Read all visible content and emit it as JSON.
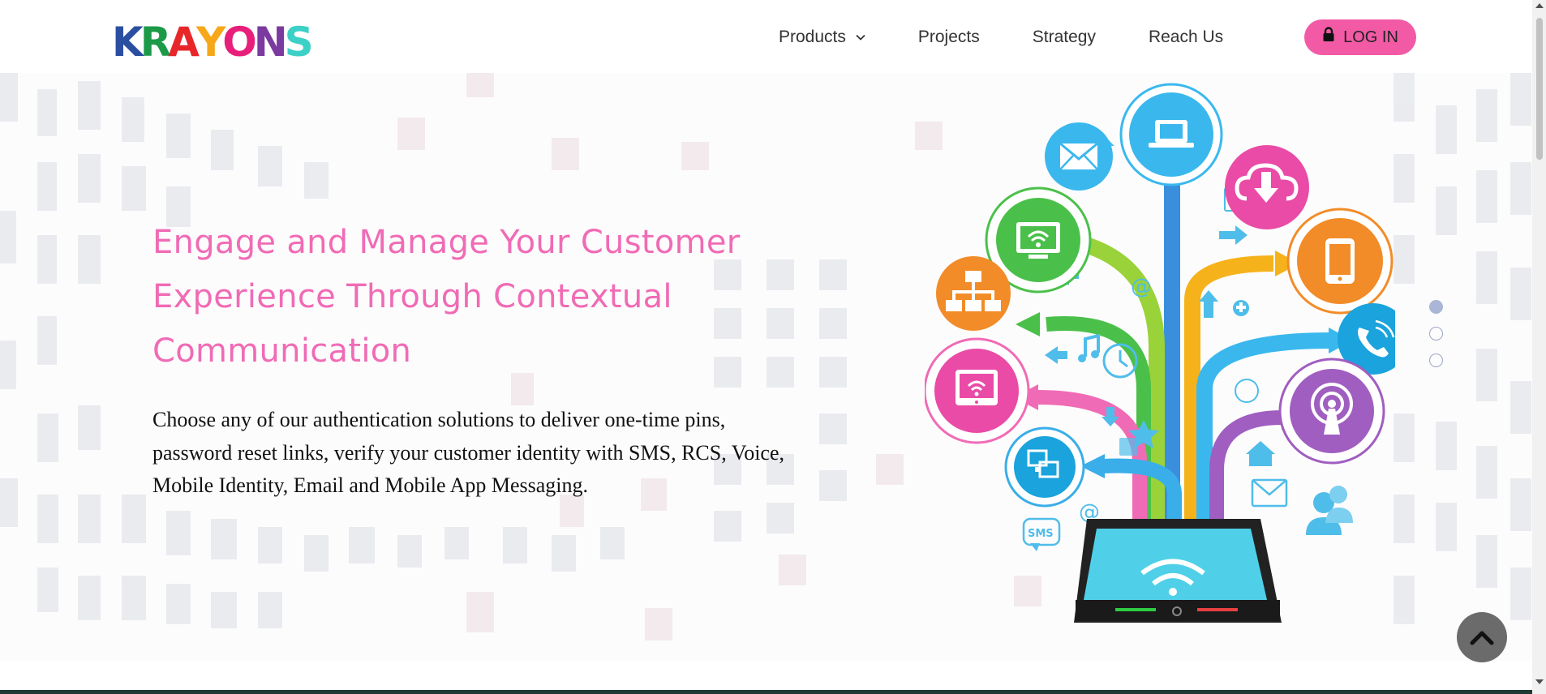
{
  "header": {
    "logo_letters": [
      "K",
      "R",
      "A",
      "Y",
      "O",
      "N",
      "S"
    ],
    "logo_colors": [
      "#2a4ea0",
      "#1c9a48",
      "#e8262a",
      "#f6a81a",
      "#e81f7a",
      "#7b3aa0",
      "#3cd0c6"
    ],
    "nav": {
      "products": "Products",
      "projects": "Projects",
      "strategy": "Strategy",
      "reach_us": "Reach Us"
    },
    "login_label": "LOG IN"
  },
  "hero": {
    "title_lines": [
      "Engage and Manage Your Customer",
      "Experience Through Contextual",
      "Communication"
    ],
    "description_lines": [
      "Choose any of our authentication solutions to deliver one-time pins,",
      "password reset links, verify your customer identity with SMS, RCS, Voice,",
      "Mobile Identity, Email and Mobile App Messaging."
    ],
    "illustration_labels": {
      "sms": "SMS",
      "at": "@"
    }
  },
  "carousel": {
    "active_index": 0,
    "count": 3
  },
  "colors": {
    "accent_pink": "#f06bb5",
    "login_bg": "#f25aa6",
    "scroll_top_bg": "#6b6b6b"
  },
  "icons": [
    "chevron-down-icon",
    "lock-icon",
    "chevron-up-icon",
    "envelope-icon",
    "laptop-icon",
    "download-cloud-icon",
    "wifi-monitor-icon",
    "sitemap-icon",
    "mobile-icon",
    "phone-icon",
    "podcast-icon",
    "devices-icon",
    "tablet-icon",
    "users-icon",
    "home-icon"
  ]
}
